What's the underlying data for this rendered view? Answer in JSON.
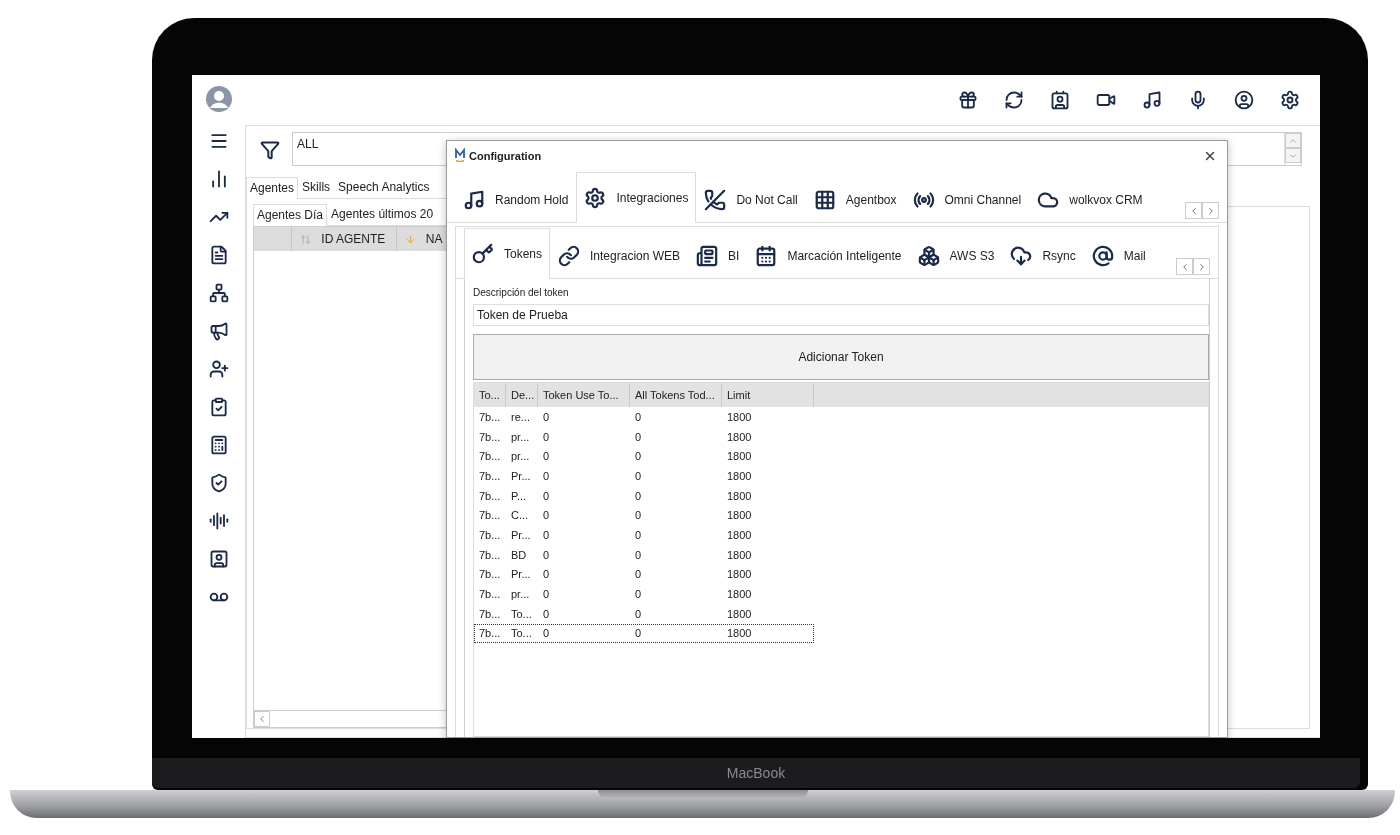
{
  "filter": {
    "value": "ALL"
  },
  "main_tabs": [
    {
      "label": "Agentes",
      "selected": true
    },
    {
      "label": "Skills",
      "selected": false
    },
    {
      "label": "Speech Analytics",
      "selected": false
    }
  ],
  "sub_tabs": [
    {
      "label": "Agentes Día",
      "selected": true
    },
    {
      "label": "Agentes últimos 20",
      "selected": false
    }
  ],
  "agents_table": {
    "columns": [
      "ID AGENTE",
      "NA"
    ]
  },
  "dialog": {
    "title": "Configuration",
    "tabs": [
      {
        "label": "Random Hold",
        "selected": false
      },
      {
        "label": "Integraciones",
        "selected": true
      },
      {
        "label": "Do Not Call",
        "selected": false
      },
      {
        "label": "Agentbox",
        "selected": false
      },
      {
        "label": "Omni Channel",
        "selected": false
      },
      {
        "label": "wolkvox CRM",
        "selected": false
      }
    ],
    "sub_tabs": [
      {
        "label": "Tokens",
        "selected": true
      },
      {
        "label": "Integracion WEB",
        "selected": false
      },
      {
        "label": "BI",
        "selected": false
      },
      {
        "label": "Marcación Inteligente",
        "selected": false
      },
      {
        "label": "AWS S3",
        "selected": false
      },
      {
        "label": "Rsync",
        "selected": false
      },
      {
        "label": "Mail",
        "selected": false
      }
    ],
    "description_label": "Descripción del token",
    "description_value": "Token de Prueba",
    "add_button": "Adicionar Token",
    "table": {
      "columns": [
        "To...",
        "De...",
        "Token Use To...",
        "All Tokens Tod...",
        "Limit"
      ],
      "rows": [
        {
          "cells": [
            "7b...",
            "re...",
            "0",
            "0",
            "1800"
          ],
          "selected": false
        },
        {
          "cells": [
            "7b...",
            "pr...",
            "0",
            "0",
            "1800"
          ],
          "selected": false
        },
        {
          "cells": [
            "7b...",
            "pr...",
            "0",
            "0",
            "1800"
          ],
          "selected": false
        },
        {
          "cells": [
            "7b...",
            "Pr...",
            "0",
            "0",
            "1800"
          ],
          "selected": false
        },
        {
          "cells": [
            "7b...",
            "P...",
            "0",
            "0",
            "1800"
          ],
          "selected": false
        },
        {
          "cells": [
            "7b...",
            "C...",
            "0",
            "0",
            "1800"
          ],
          "selected": false
        },
        {
          "cells": [
            "7b...",
            "Pr...",
            "0",
            "0",
            "1800"
          ],
          "selected": false
        },
        {
          "cells": [
            "7b...",
            "BD",
            "0",
            "0",
            "1800"
          ],
          "selected": false
        },
        {
          "cells": [
            "7b...",
            "Pr...",
            "0",
            "0",
            "1800"
          ],
          "selected": false
        },
        {
          "cells": [
            "7b...",
            "pr...",
            "0",
            "0",
            "1800"
          ],
          "selected": false
        },
        {
          "cells": [
            "7b...",
            "To...",
            "0",
            "0",
            "1800"
          ],
          "selected": false
        },
        {
          "cells": [
            "7b...",
            "To...",
            "0",
            "0",
            "1800"
          ],
          "selected": true
        }
      ]
    }
  },
  "laptop": {
    "label": "MacBook"
  }
}
